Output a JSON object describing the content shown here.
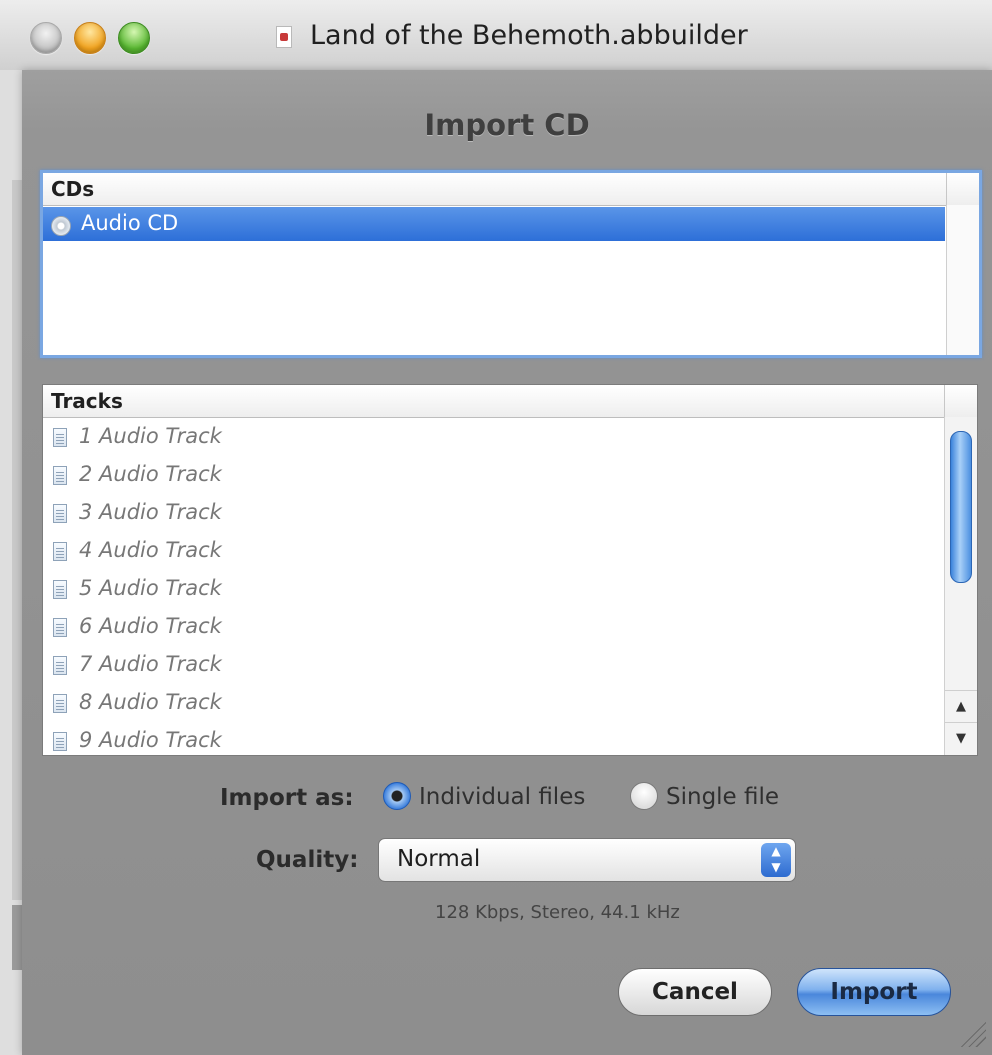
{
  "window": {
    "title": "Land of the Behemoth.abbuilder"
  },
  "sheet": {
    "title": "Import CD",
    "cds": {
      "header": "CDs",
      "items": [
        {
          "label": "Audio CD",
          "selected": true
        }
      ]
    },
    "tracks": {
      "header": "Tracks",
      "items": [
        "1 Audio Track",
        "2 Audio Track",
        "3 Audio Track",
        "4 Audio Track",
        "5 Audio Track",
        "6 Audio Track",
        "7 Audio Track",
        "8 Audio Track",
        "9 Audio Track"
      ]
    },
    "import_as": {
      "label": "Import as:",
      "options": [
        "Individual files",
        "Single file"
      ],
      "selected": "Individual files"
    },
    "quality": {
      "label": "Quality:",
      "value": "Normal",
      "description": "128 Kbps, Stereo, 44.1 kHz"
    },
    "buttons": {
      "cancel": "Cancel",
      "import": "Import"
    }
  }
}
